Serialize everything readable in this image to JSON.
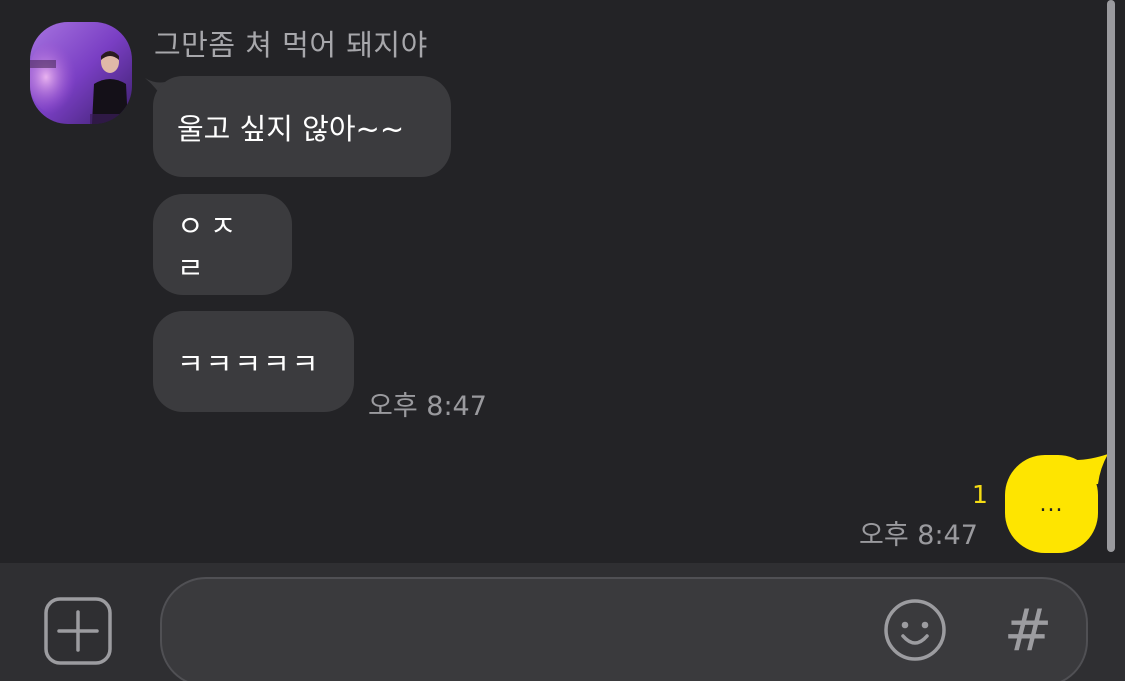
{
  "chat": {
    "sender_name": "그만좀 쳐 먹어 돼지야",
    "incoming_messages": [
      {
        "text": "울고 싶지 않아~~"
      },
      {
        "text": "ㅇㅈㄹ"
      },
      {
        "text": "ㅋㅋㅋㅋㅋ"
      }
    ],
    "incoming_time": "오후 8:47",
    "outgoing": {
      "text": "...",
      "read_count": "1",
      "time": "오후 8:47"
    }
  },
  "input_bar": {
    "message_value": "",
    "hash_label": "#"
  },
  "icons": {
    "add": "plus-icon",
    "emoji": "emoji-icon",
    "hashtag": "hashtag-icon"
  },
  "colors": {
    "background": "#232326",
    "incoming_bubble": "#3b3b3e",
    "outgoing_bubble": "#fee500",
    "read_count": "#f5dc14",
    "input_bar": "#2f2f32"
  }
}
